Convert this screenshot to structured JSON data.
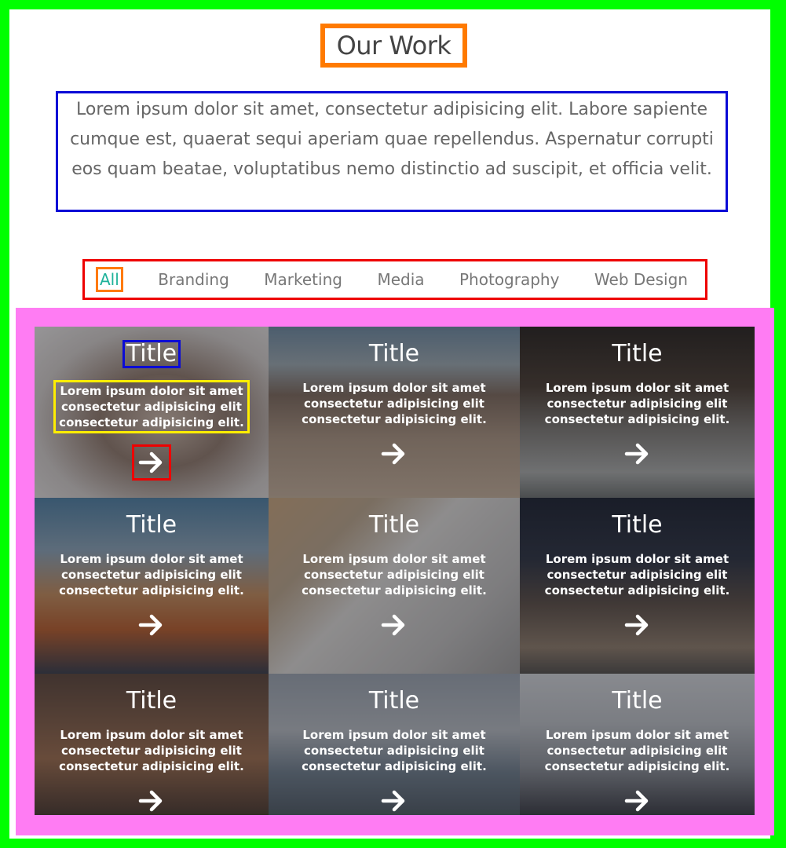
{
  "section": {
    "title": "Our Work",
    "description": "Lorem ipsum dolor sit amet, consectetur adipisicing elit. Labore sapiente cumque est, quaerat sequi aperiam quae repellendus. Aspernatur corrupti eos quam beatae, voluptatibus nemo distinctio ad suscipit, et officia velit."
  },
  "filters": {
    "items": [
      "All",
      "Branding",
      "Marketing",
      "Media",
      "Photography",
      "Web Design"
    ],
    "active": "All",
    "active_color": "#1fb29a"
  },
  "portfolio": {
    "items": [
      {
        "title": "Title",
        "text": "Lorem ipsum dolor sit amet consectetur adipisicing elit consectetur adipisicing elit.",
        "icon": "arrow-right-icon"
      },
      {
        "title": "Title",
        "text": "Lorem ipsum dolor sit amet consectetur adipisicing elit consectetur adipisicing elit.",
        "icon": "arrow-right-icon"
      },
      {
        "title": "Title",
        "text": "Lorem ipsum dolor sit amet consectetur adipisicing elit consectetur adipisicing elit.",
        "icon": "arrow-right-icon"
      },
      {
        "title": "Title",
        "text": "Lorem ipsum dolor sit amet consectetur adipisicing elit consectetur adipisicing elit.",
        "icon": "arrow-right-icon"
      },
      {
        "title": "Title",
        "text": "Lorem ipsum dolor sit amet consectetur adipisicing elit consectetur adipisicing elit.",
        "icon": "arrow-right-icon"
      },
      {
        "title": "Title",
        "text": "Lorem ipsum dolor sit amet consectetur adipisicing elit consectetur adipisicing elit.",
        "icon": "arrow-right-icon"
      },
      {
        "title": "Title",
        "text": "Lorem ipsum dolor sit amet consectetur adipisicing elit consectetur adipisicing elit.",
        "icon": "arrow-right-icon"
      },
      {
        "title": "Title",
        "text": "Lorem ipsum dolor sit amet consectetur adipisicing elit consectetur adipisicing elit.",
        "icon": "arrow-right-icon"
      },
      {
        "title": "Title",
        "text": "Lorem ipsum dolor sit amet consectetur adipisicing elit consectetur adipisicing elit.",
        "icon": "arrow-right-icon"
      }
    ]
  }
}
